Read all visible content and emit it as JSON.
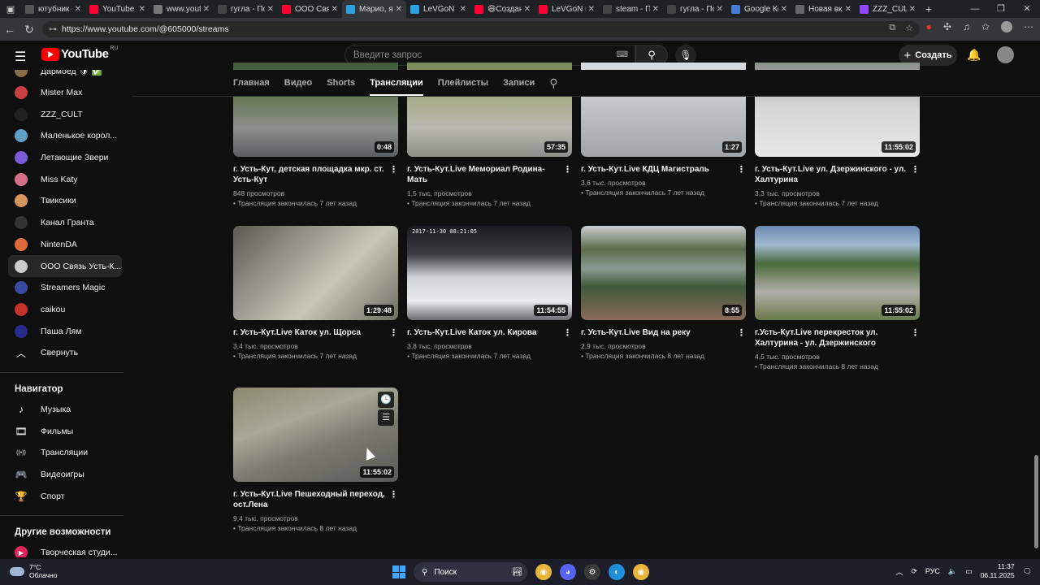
{
  "browser": {
    "tabs": [
      {
        "title": "ютубник -",
        "color": "#555555"
      },
      {
        "title": "YouTube",
        "color": "#ff0033"
      },
      {
        "title": "www.youtu",
        "color": "#777777"
      },
      {
        "title": "гугла - Пои",
        "color": "#444444"
      },
      {
        "title": "ООО Связ",
        "color": "#ff0033"
      },
      {
        "title": "Марио, яп",
        "color": "#2aa1e0"
      },
      {
        "title": "LeVGoN 🛡",
        "color": "#2aa1e0"
      },
      {
        "title": "😄Создан",
        "color": "#ff0033"
      },
      {
        "title": "LeVGoN н",
        "color": "#ff0033"
      },
      {
        "title": "steam - П",
        "color": "#444444"
      },
      {
        "title": "гугла - Пои",
        "color": "#444444"
      },
      {
        "title": "Google Ко",
        "color": "#4a7bd6"
      },
      {
        "title": "Новая вкл",
        "color": "#666666"
      },
      {
        "title": "ZZZ_CULT",
        "color": "#9146ff"
      }
    ],
    "active_tab_index": 5,
    "url": "https://www.youtube.com/@605000/streams"
  },
  "header": {
    "logo_text": "YouTube",
    "region": "RU",
    "search_placeholder": "Введите запрос",
    "create_label": "Создать"
  },
  "sidebar": {
    "subscriptions": [
      {
        "label": "Дармоед 🛡 ✅",
        "color": "#8a6d4a"
      },
      {
        "label": "Mister Max",
        "color": "#c94040"
      },
      {
        "label": "ZZZ_CULT",
        "color": "#222222"
      },
      {
        "label": "Маленькое корол...",
        "color": "#5fa0c9"
      },
      {
        "label": "Летающие Звери",
        "color": "#7b5cd6"
      },
      {
        "label": "Miss Katy",
        "color": "#d6708a"
      },
      {
        "label": "Твиксики",
        "color": "#d6955c"
      },
      {
        "label": "Канал Гранта",
        "color": "#333333"
      },
      {
        "label": "NintenDA",
        "color": "#e06a3a"
      },
      {
        "label": "ООО Связь Усть-К...",
        "color": "#cccccc"
      },
      {
        "label": "Streamers Magic",
        "color": "#3a4aa0"
      },
      {
        "label": "caikou",
        "color": "#c4342a"
      },
      {
        "label": "Паша Лям",
        "color": "#2a2a8a"
      }
    ],
    "active_subscription_index": 9,
    "collapse_label": "Свернуть",
    "navigator_title": "Навигатор",
    "navigator_items": [
      {
        "label": "Музыка",
        "icon": "music-note-icon"
      },
      {
        "label": "Фильмы",
        "icon": "film-icon"
      },
      {
        "label": "Трансляции",
        "icon": "live-icon"
      },
      {
        "label": "Видеоигры",
        "icon": "gamepad-icon"
      },
      {
        "label": "Спорт",
        "icon": "trophy-icon"
      }
    ],
    "other_title": "Другие возможности",
    "studio_label": "Творческая студи..."
  },
  "channel_tabs": [
    "Главная",
    "Видео",
    "Shorts",
    "Трансляции",
    "Плейлисты",
    "Записи"
  ],
  "active_channel_tab": 3,
  "videos": [
    {
      "title": "г. Усть-Кут, детская площадка мкр. ст. Усть-Кут",
      "duration": "0:48",
      "views": "848 просмотров",
      "ended": "• Трансляция закончилась 7 лет назад",
      "bg": "linear-gradient(180deg,#3f5a3a 0%,#6b7a5c 40%,#8a8f8a 70%,#5a5e62 100%)"
    },
    {
      "title": "г. Усть-Кут.Live Мемориал Родина-Мать",
      "duration": "57:35",
      "views": "1,5 тыс. просмотров",
      "ended": "• Трансляция закончилась 7 лет назад",
      "bg": "linear-gradient(180deg,#7a8a5a 0%,#a9ad8e 40%,#b8b8b0 70%,#8d8f88 100%)"
    },
    {
      "title": "г. Усть-Кут.Live КДЦ Магистраль",
      "duration": "1:27",
      "views": "3,6 тыс. просмотров",
      "ended": "• Трансляция закончилась 7 лет назад",
      "bg": "linear-gradient(180deg,#d8dce0 0%,#c4c8cc 40%,#9ea4a8 100%)"
    },
    {
      "title": "г. Усть-Кут.Live ул. Дзержинского - ул. Халтурина",
      "duration": "11:55:02",
      "views": "3,3 тыс. просмотров",
      "ended": "• Трансляция закончилась 7 лет назад",
      "bg": "linear-gradient(180deg,#8a8f8a 0%,#d4d6d6 45%,#e6e8e8 100%)"
    },
    {
      "title": "г. Усть-Кут.Live Каток ул. Щорса",
      "duration": "1:29:48",
      "views": "3,4 тыс. просмотров",
      "ended": "• Трансляция закончилась 7 лет назад",
      "bg": "linear-gradient(135deg,#5a5a52 0%,#9a9a90 35%,#c8c8b8 60%,#6c6c62 100%)"
    },
    {
      "title": "г. Усть-Кут.Live Каток ул. Кирова",
      "duration": "11:54:55",
      "views": "3,8 тыс. просмотров",
      "ended": "• Трансляция закончилась 7 лет назад",
      "bg": "linear-gradient(180deg,#1a1c22 0%,#3a3c42 30%,#d0d4d8 55%,#e8eaec 80%,#6a6c70 100%)"
    },
    {
      "title": "г. Усть-Кут.Live Вид на реку",
      "duration": "8:55",
      "views": "2,9 тыс. просмотров",
      "ended": "• Трансляция закончилась 8 лет назад",
      "bg": "linear-gradient(180deg,#c8ccd0 0%,#5a6a4a 25%,#8a9a90 45%,#3f5a3a 65%,#8a6a5a 100%)"
    },
    {
      "title": "г.Усть-Кут.Live перекресток ул. Халтурина - ул. Дзержинского",
      "duration": "11:55:02",
      "views": "4,5 тыс. просмотров",
      "ended": "• Трансляция закончилась 8 лет назад",
      "bg": "linear-gradient(180deg,#6a8ab0 0%,#a0b8d0 20%,#4a6a3a 40%,#b0b0a8 70%,#6a7a4a 100%)"
    },
    {
      "title": "г. Усть-Кут.Live Пешеходный переход, ост.Лена",
      "duration": "11:55:02",
      "views": "9,4 тыс. просмотров",
      "ended": "• Трансляция закончилась 8 лет назад",
      "bg": "linear-gradient(160deg,#8a8a70 0%,#a8a898 35%,#7a7a70 60%,#5a5a58 100%)"
    }
  ],
  "thumb_timestamp": "2017-11-30 08:21:05",
  "taskbar": {
    "temp": "7°C",
    "weather": "Облачно",
    "search_label": "Поиск",
    "lang": "РУС",
    "time": "11:37",
    "date": "06.11.2025"
  }
}
